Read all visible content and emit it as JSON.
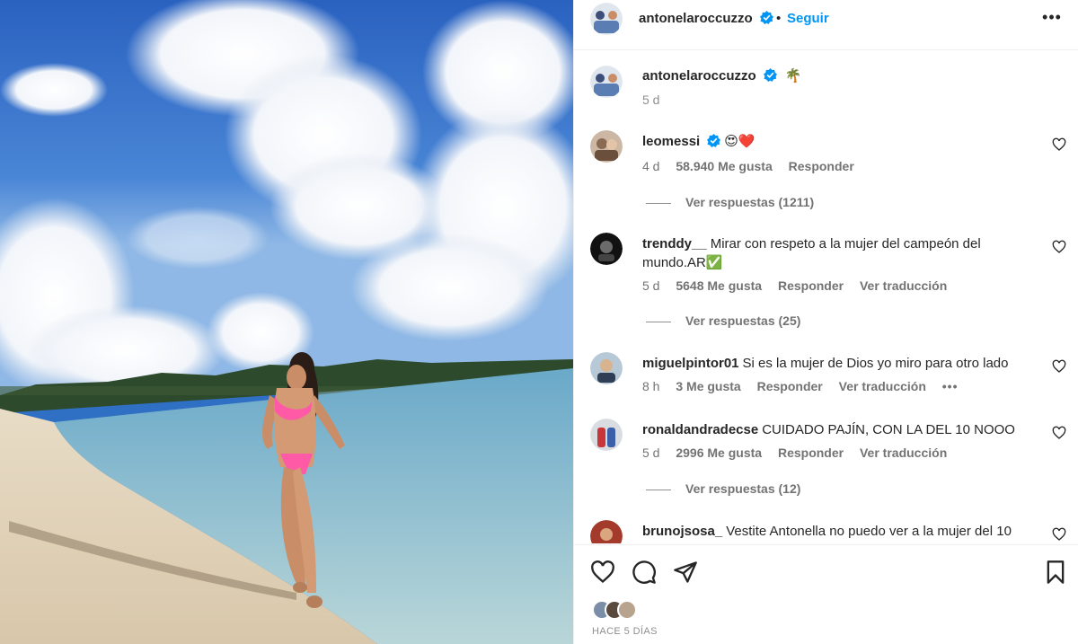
{
  "post": {
    "author": "antonelaroccuzzo",
    "follow_label": "Seguir",
    "separator": "•",
    "more_glyph": "•••",
    "caption_text": "🌴",
    "caption_time": "5 d",
    "posted_label": "HACE 5 DÍAS"
  },
  "comments": [
    {
      "username": "leomessi",
      "verified": true,
      "text": "😍❤️",
      "time": "4 d",
      "likes": "58.940 Me gusta",
      "reply_label": "Responder",
      "translate_label": "",
      "replies_label": "Ver respuestas (1211)"
    },
    {
      "username": "trenddy__",
      "verified": false,
      "text": "Mirar con respeto a la mujer del campeón del mundo.AR✅",
      "time": "5 d",
      "likes": "5648 Me gusta",
      "reply_label": "Responder",
      "translate_label": "Ver traducción",
      "replies_label": "Ver respuestas (25)"
    },
    {
      "username": "miguelpintor01",
      "verified": false,
      "text": "Si es la mujer de Dios yo miro para otro lado",
      "time": "8 h",
      "likes": "3 Me gusta",
      "reply_label": "Responder",
      "translate_label": "Ver traducción",
      "replies_label": ""
    },
    {
      "username": "ronaldandradecse",
      "verified": false,
      "text": "CUIDADO PAJÍN, CON LA DEL 10 NOOO",
      "time": "5 d",
      "likes": "2996 Me gusta",
      "reply_label": "Responder",
      "translate_label": "Ver traducción",
      "replies_label": "Ver respuestas (12)"
    },
    {
      "username": "brunojsosa_",
      "verified": false,
      "text": "Vestite Antonella no puedo ver a la mujer del 10",
      "time": "",
      "likes": "",
      "reply_label": "",
      "translate_label": "",
      "replies_label": ""
    }
  ],
  "icons": {
    "like": "heart-icon",
    "comment": "comment-icon",
    "share": "send-icon",
    "save": "bookmark-icon",
    "verified": "verified-badge-icon"
  },
  "colors": {
    "link_blue": "#0095f6",
    "verified_blue": "#0095f6",
    "muted_text": "#737373"
  }
}
